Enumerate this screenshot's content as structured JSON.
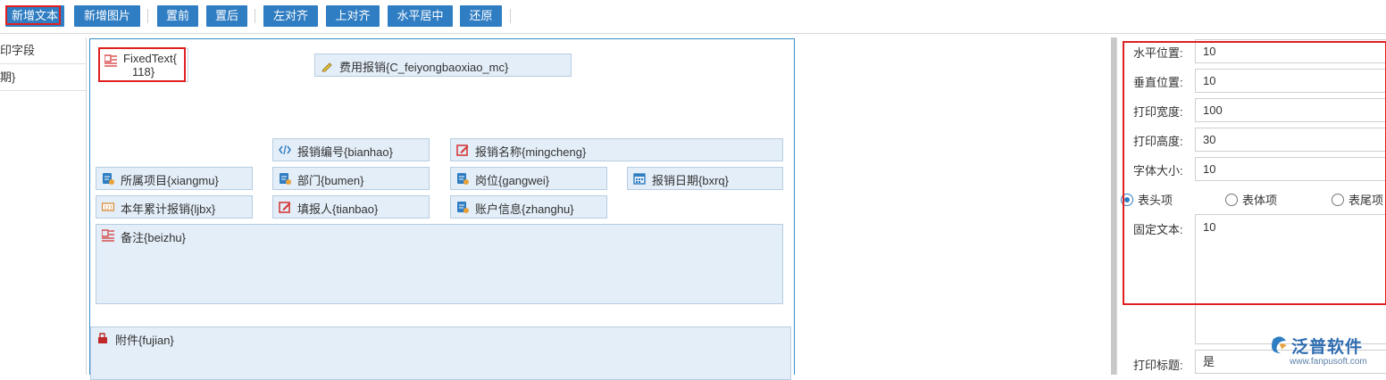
{
  "toolbar": {
    "buttons": [
      "新增文本",
      "新增图片",
      "置前",
      "置后",
      "左对齐",
      "上对齐",
      "水平居中",
      "还原"
    ]
  },
  "left_list": {
    "items": [
      "印字段",
      "期}"
    ]
  },
  "canvas": {
    "fixed_text": "FixedText{",
    "fixed_text_line2": "118}",
    "fields": {
      "feiyong": "费用报销{C_feiyongbaoxiao_mc}",
      "bianhao": "报销编号{bianhao}",
      "mingcheng": "报销名称{mingcheng}",
      "xiangmu": "所属项目{xiangmu}",
      "bumen": "部门{bumen}",
      "gangwei": "岗位{gangwei}",
      "bxrq": "报销日期{bxrq}",
      "ljbx": "本年累计报销{ljbx}",
      "tianbao": "填报人{tianbao}",
      "zhanghu": "账户信息{zhanghu}",
      "beizhu": "备注{beizhu}",
      "fujian": "附件{fujian}"
    }
  },
  "properties": {
    "h_pos_label": "水平位置:",
    "h_pos_value": "10",
    "v_pos_label": "垂直位置:",
    "v_pos_value": "10",
    "width_label": "打印宽度:",
    "width_value": "100",
    "height_label": "打印高度:",
    "height_value": "30",
    "font_label": "字体大小:",
    "font_value": "10",
    "radio_header": "表头项",
    "radio_body": "表体项",
    "radio_footer": "表尾项",
    "radio_selected": "表头项",
    "fixed_label": "固定文本:",
    "fixed_value": "10",
    "title_label": "打印标题:",
    "title_value": "是"
  },
  "logo": {
    "name": "泛普软件",
    "url": "www.fanpusoft.com"
  },
  "colors": {
    "button_bg": "#2f7dc2",
    "highlight_red": "#e02020",
    "field_bg": "#e3eef8"
  }
}
